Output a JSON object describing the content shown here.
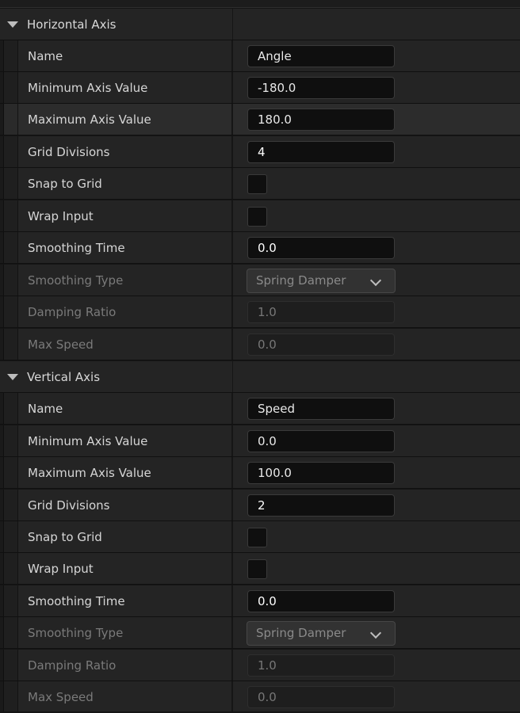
{
  "sections": [
    {
      "title": "Horizontal Axis",
      "rows": [
        {
          "label": "Name",
          "type": "text",
          "value": "Angle"
        },
        {
          "label": "Minimum Axis Value",
          "type": "text",
          "value": "-180.0"
        },
        {
          "label": "Maximum Axis Value",
          "type": "text",
          "value": "180.0",
          "highlighted": true
        },
        {
          "label": "Grid Divisions",
          "type": "number",
          "value": "4"
        },
        {
          "label": "Snap to Grid",
          "type": "checkbox",
          "checked": false
        },
        {
          "label": "Wrap Input",
          "type": "checkbox",
          "checked": false
        },
        {
          "label": "Smoothing Time",
          "type": "number",
          "value": "0.0"
        },
        {
          "label": "Smoothing Type",
          "type": "dropdown",
          "value": "Spring Damper",
          "disabled": true
        },
        {
          "label": "Damping Ratio",
          "type": "text",
          "value": "1.0",
          "disabled": true
        },
        {
          "label": "Max Speed",
          "type": "text",
          "value": "0.0",
          "disabled": true
        }
      ]
    },
    {
      "title": "Vertical Axis",
      "rows": [
        {
          "label": "Name",
          "type": "text",
          "value": "Speed"
        },
        {
          "label": "Minimum Axis Value",
          "type": "text",
          "value": "0.0"
        },
        {
          "label": "Maximum Axis Value",
          "type": "text",
          "value": "100.0"
        },
        {
          "label": "Grid Divisions",
          "type": "number",
          "value": "2"
        },
        {
          "label": "Snap to Grid",
          "type": "checkbox",
          "checked": false
        },
        {
          "label": "Wrap Input",
          "type": "checkbox",
          "checked": false
        },
        {
          "label": "Smoothing Time",
          "type": "number",
          "value": "0.0"
        },
        {
          "label": "Smoothing Type",
          "type": "dropdown",
          "value": "Spring Damper",
          "disabled": true
        },
        {
          "label": "Damping Ratio",
          "type": "text",
          "value": "1.0",
          "disabled": true
        },
        {
          "label": "Max Speed",
          "type": "text",
          "value": "0.0",
          "disabled": true
        }
      ]
    }
  ]
}
